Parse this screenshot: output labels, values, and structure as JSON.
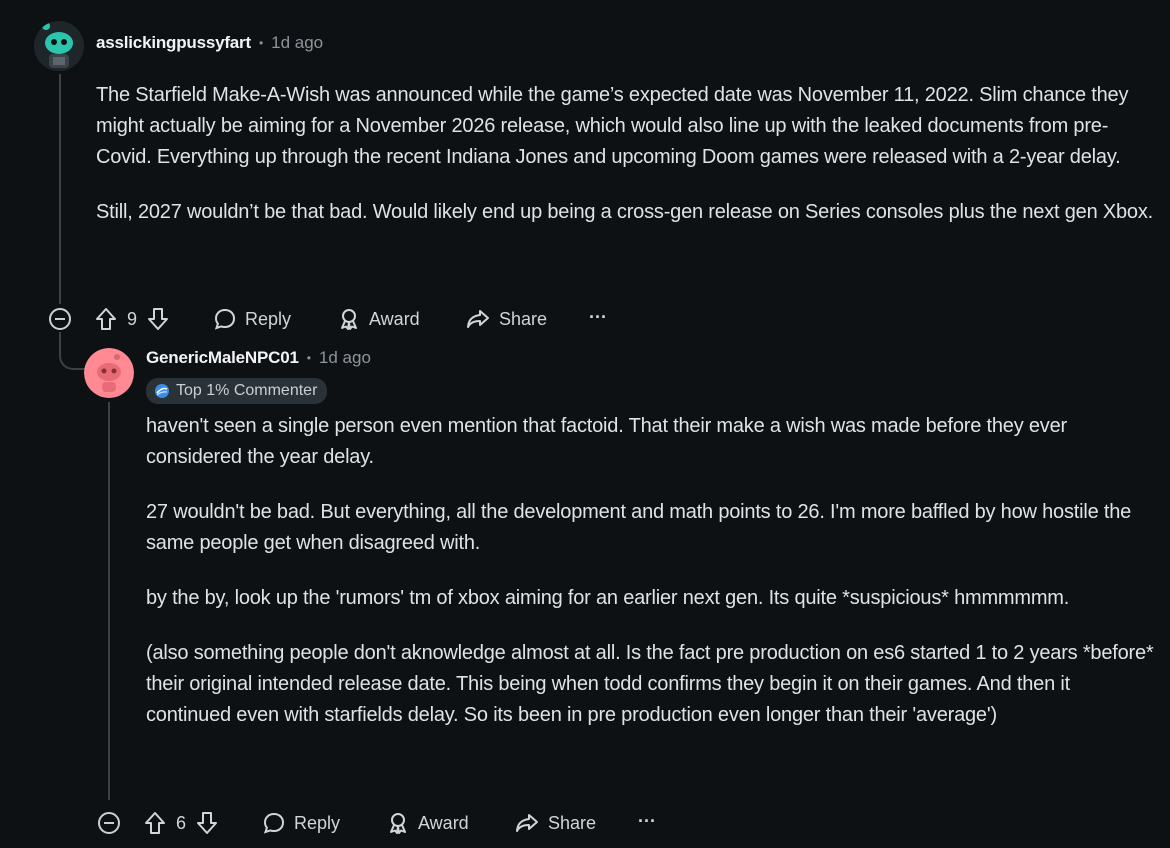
{
  "comment1": {
    "username": "asslickingpussyfart",
    "timestamp": "1d ago",
    "paragraphs": [
      "The Starfield Make-A-Wish was announced while the game’s expected date was November 11, 2022. Slim chance they might actually be aiming for a November 2026 release, which would also line up with the leaked documents from pre-Covid. Everything up through the recent Indiana Jones and upcoming Doom games were released with a 2-year delay.",
      "Still, 2027 wouldn’t be that bad. Would likely end up being a cross-gen release on Series consoles plus the next gen Xbox."
    ],
    "vote_count": "9",
    "reply_label": "Reply",
    "award_label": "Award",
    "share_label": "Share",
    "more_label": "···",
    "avatar_color": "#2bc4ad"
  },
  "comment2": {
    "username": "GenericMaleNPC01",
    "timestamp": "1d ago",
    "flair": "Top 1% Commenter",
    "paragraphs": [
      "haven't seen a single person even mention that factoid. That their make a wish was made before they ever considered the year delay.",
      "27 wouldn't be bad. But everything, all the development and math points to 26. I'm more baffled by how hostile the same people get when disagreed with.",
      "by the by, look up the 'rumors' tm of xbox aiming for an earlier next gen. Its quite *suspicious* hmmmmmm.",
      "(also something people don't aknowledge almost at all. Is the fact pre production on es6 started 1 to 2 years *before* their original intended release date. This being when todd confirms they begin it on their games. And then it continued even with starfields delay. So its been in pre production even longer than their 'average')"
    ],
    "vote_count": "6",
    "reply_label": "Reply",
    "award_label": "Award",
    "share_label": "Share",
    "more_label": "···",
    "avatar_color": "#ff8a93"
  },
  "separator_dot": "•"
}
